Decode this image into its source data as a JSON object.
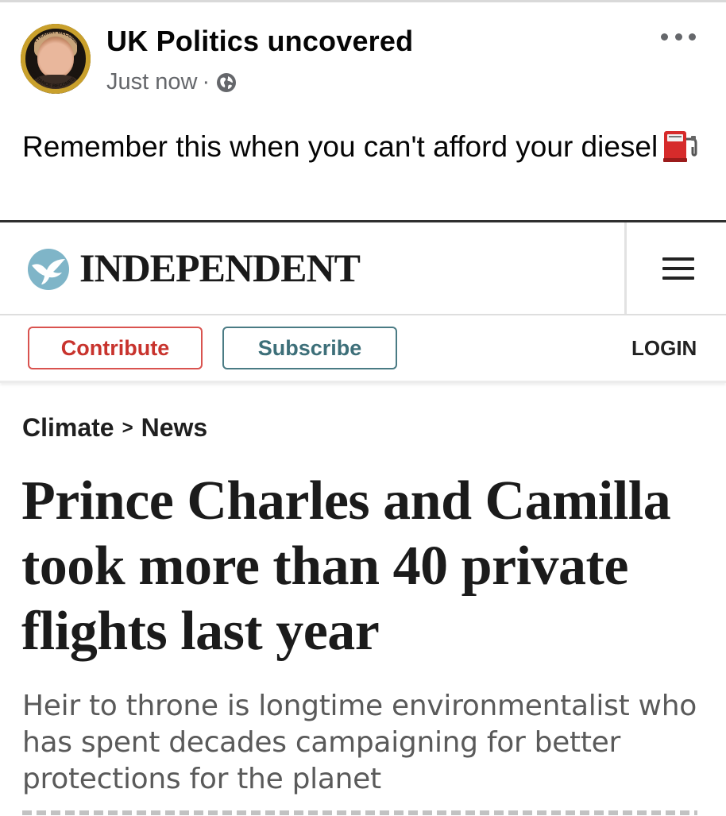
{
  "post": {
    "page_name": "UK Politics uncovered",
    "timestamp": "Just now",
    "separator": "·",
    "privacy_icon": "globe-icon",
    "menu_icon": "more-options-icon",
    "text": "Remember this when you can't afford your diesel",
    "emoji": "fuel-pump"
  },
  "avatar": {
    "ring_text_top": "WHEN TYRANNY BECOMES LAW",
    "ring_text_bottom": "RESISTANCE BECOMES DUTY"
  },
  "independent": {
    "logo": "INDEPENDENT",
    "logo_icon": "eagle-icon",
    "menu_icon": "hamburger-menu-icon",
    "contribute_label": "Contribute",
    "subscribe_label": "Subscribe",
    "login_label": "LOGIN",
    "breadcrumb": {
      "section": "Climate",
      "separator": ">",
      "subsection": "News"
    },
    "headline": "Prince Charles and Camilla took more than 40 private flights last year",
    "standfirst": "Heir to throne is longtime environmentalist who has spent decades campaigning for better protections for the planet"
  },
  "colors": {
    "contribute": "#c8332d",
    "subscribe": "#3d6f79",
    "meta_gray": "#65676b",
    "standfirst_gray": "#5a5a5a"
  }
}
